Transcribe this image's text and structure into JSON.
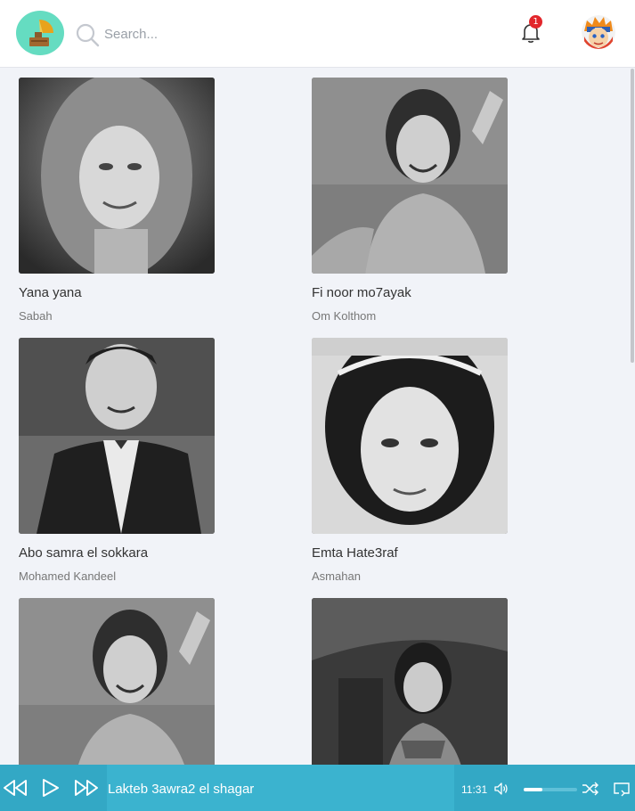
{
  "header": {
    "search_placeholder": "Search...",
    "notification_count": "1"
  },
  "songs": [
    {
      "title": "Yana yana",
      "artist": "Sabah"
    },
    {
      "title": "Fi noor mo7ayak",
      "artist": "Om Kolthom"
    },
    {
      "title": "Abo samra el sokkara",
      "artist": "Mohamed Kandeel"
    },
    {
      "title": "Emta Hate3raf",
      "artist": "Asmahan"
    },
    {
      "title": "",
      "artist": ""
    },
    {
      "title": "",
      "artist": ""
    }
  ],
  "player": {
    "now_playing": "Lakteb 3awra2 el shagar",
    "time": "11:31",
    "volume": 0.35
  },
  "colors": {
    "accent": "#33a8c5",
    "logo_bg": "#65dcc1",
    "badge": "#e2262b"
  }
}
